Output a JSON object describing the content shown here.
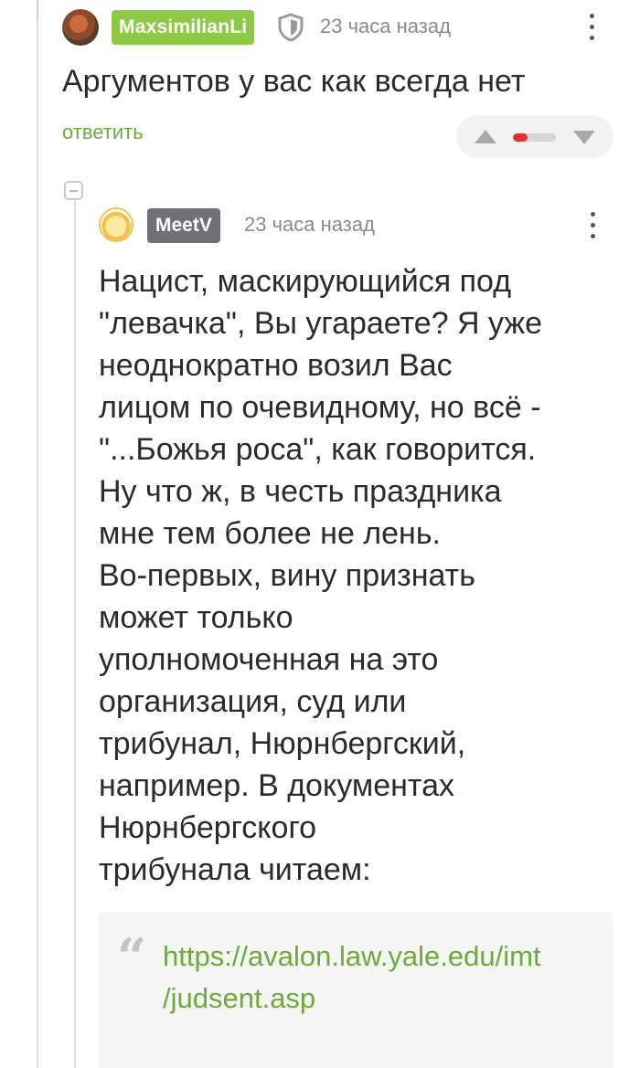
{
  "comment1": {
    "username": "MaxsimilianLi",
    "timestamp": "23 часа назад",
    "text": "Аргументов у вас как всегда нет",
    "reply_label": "ответить",
    "rating_negative_fraction": 0.35,
    "icons": [
      "avatar",
      "shield-icon",
      "more-icon",
      "upvote-icon",
      "downvote-icon"
    ]
  },
  "comment2": {
    "username": "MeetV",
    "timestamp": "23 часа назад",
    "text": "Нацист, маскирующийся под\n\"левачка\", Вы угараете? Я уже\nнеоднократно возил Вас\nлицом по очевидному, но всё -\n\"...Божья роса\", как говорится.\nНу что ж, в честь праздника\nмне тем более не лень.\nВо-первых, вину признать\nможет только\nуполномоченная на это\nорганизация, суд или\nтрибунал, Нюрнбергский,\nнапример. В документах\nНюрнбергского\nтрибунала читаем:",
    "quote_link": "https://avalon.law.yale.edu/imt\n/judsent.asp",
    "icons": [
      "avatar",
      "more-icon",
      "collapse-icon",
      "quote-icon"
    ]
  },
  "colors": {
    "accent_green": "#8ec945",
    "link_green": "#6cab3a",
    "badge_gray": "#6f7176",
    "rating_red": "#e0322f"
  }
}
